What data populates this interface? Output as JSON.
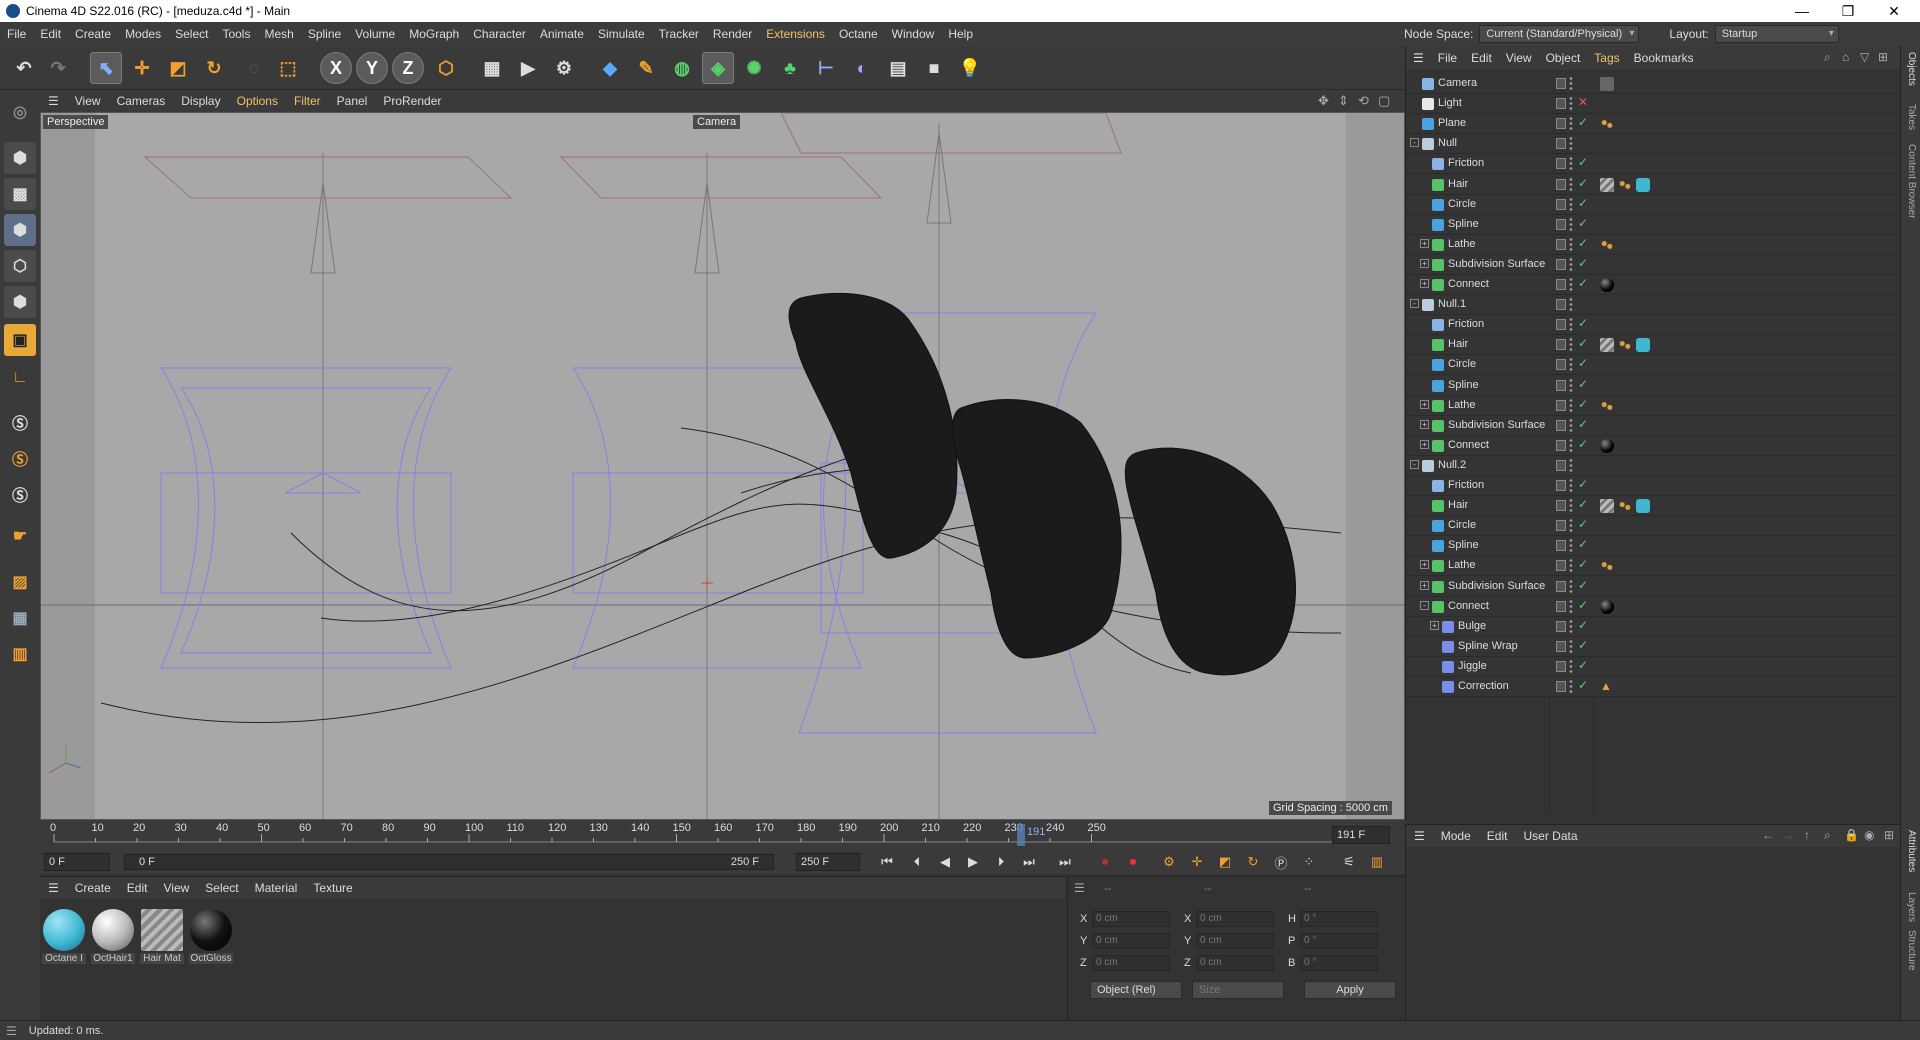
{
  "window": {
    "title": "Cinema 4D S22.016 (RC) - [meduza.c4d *] - Main",
    "minimize": "—",
    "maximize": "❐",
    "close": "✕"
  },
  "menubar": {
    "items": [
      "File",
      "Edit",
      "Create",
      "Modes",
      "Select",
      "Tools",
      "Mesh",
      "Spline",
      "Volume",
      "MoGraph",
      "Character",
      "Animate",
      "Simulate",
      "Tracker",
      "Render",
      "Extensions",
      "Octane",
      "Window",
      "Help"
    ],
    "node_space_label": "Node Space:",
    "node_space_value": "Current (Standard/Physical)",
    "layout_label": "Layout:",
    "layout_value": "Startup"
  },
  "toolbar": {
    "undo": "undo-icon",
    "redo": "redo-icon",
    "axis_x": "X",
    "axis_y": "Y",
    "axis_z": "Z"
  },
  "viewport": {
    "menu": [
      "View",
      "Cameras",
      "Display",
      "Options",
      "Filter",
      "Panel",
      "ProRender"
    ],
    "label": "Perspective",
    "camera_label": "Camera",
    "grid_spacing": "Grid Spacing : 5000 cm"
  },
  "timeline": {
    "ticks": [
      "0",
      "10",
      "20",
      "30",
      "40",
      "50",
      "60",
      "70",
      "80",
      "90",
      "100",
      "110",
      "120",
      "130",
      "140",
      "150",
      "160",
      "170",
      "180",
      "190",
      "200",
      "210",
      "220",
      "230",
      "240",
      "250"
    ],
    "current_marker": "191",
    "current_frame_field": "191 F",
    "start_field": "0 F",
    "range_start": "0 F",
    "range_end": "250 F",
    "end_field": "250 F"
  },
  "materials": {
    "menu": [
      "Create",
      "Edit",
      "View",
      "Select",
      "Material",
      "Texture"
    ],
    "items": [
      {
        "label": "Octane I",
        "color": "#3fb7d2"
      },
      {
        "label": "OctHair1",
        "color": "#bdbdbd"
      },
      {
        "label": "Hair Mat",
        "color": "#9a9a9a"
      },
      {
        "label": "OctGloss",
        "color": "#111111"
      }
    ]
  },
  "coords": {
    "header": [
      "--",
      "--",
      "--"
    ],
    "rows": [
      {
        "a": "X",
        "av": "0 cm",
        "b": "X",
        "bv": "0 cm",
        "c": "H",
        "cv": "0 °"
      },
      {
        "a": "Y",
        "av": "0 cm",
        "b": "Y",
        "bv": "0 cm",
        "c": "P",
        "cv": "0 °"
      },
      {
        "a": "Z",
        "av": "0 cm",
        "b": "Z",
        "bv": "0 cm",
        "c": "B",
        "cv": "0 °"
      }
    ],
    "mode_select": "Object (Rel)",
    "size_select": "Size",
    "apply": "Apply"
  },
  "status": {
    "text": "Updated: 0 ms."
  },
  "object_manager": {
    "menu": [
      "File",
      "Edit",
      "View",
      "Object",
      "Tags",
      "Bookmarks"
    ],
    "objects": [
      {
        "name": "Camera",
        "level": 0,
        "icon": "#8ab4e6",
        "tags": [
          "camera-tag"
        ]
      },
      {
        "name": "Light",
        "level": 0,
        "icon": "#e8e8e8",
        "tags": []
      },
      {
        "name": "Plane",
        "level": 0,
        "icon": "#4aa3e0",
        "tags": [
          "phong"
        ]
      },
      {
        "name": "Null",
        "level": 0,
        "icon": "#bcd",
        "tags": [],
        "tree": "-"
      },
      {
        "name": "Friction",
        "level": 1,
        "icon": "#8ab4e6",
        "tags": []
      },
      {
        "name": "Hair",
        "level": 1,
        "icon": "#58c26a",
        "tags": [
          "hairmat",
          "phong",
          "octane"
        ]
      },
      {
        "name": "Circle",
        "level": 1,
        "icon": "#4aa3e0",
        "tags": []
      },
      {
        "name": "Spline",
        "level": 1,
        "icon": "#4aa3e0",
        "tags": []
      },
      {
        "name": "Lathe",
        "level": 1,
        "icon": "#58c26a",
        "tags": [
          "phong"
        ],
        "tree": "+"
      },
      {
        "name": "Subdivision Surface",
        "level": 1,
        "icon": "#58c26a",
        "tags": [],
        "tree": "+"
      },
      {
        "name": "Connect",
        "level": 1,
        "icon": "#58c26a",
        "tags": [
          "black"
        ],
        "tree": "+"
      },
      {
        "name": "Null.1",
        "level": 0,
        "icon": "#bcd",
        "tags": [],
        "tree": "-"
      },
      {
        "name": "Friction",
        "level": 1,
        "icon": "#8ab4e6",
        "tags": []
      },
      {
        "name": "Hair",
        "level": 1,
        "icon": "#58c26a",
        "tags": [
          "hairmat",
          "phong",
          "octane"
        ]
      },
      {
        "name": "Circle",
        "level": 1,
        "icon": "#4aa3e0",
        "tags": []
      },
      {
        "name": "Spline",
        "level": 1,
        "icon": "#4aa3e0",
        "tags": []
      },
      {
        "name": "Lathe",
        "level": 1,
        "icon": "#58c26a",
        "tags": [
          "phong"
        ],
        "tree": "+"
      },
      {
        "name": "Subdivision Surface",
        "level": 1,
        "icon": "#58c26a",
        "tags": [],
        "tree": "+"
      },
      {
        "name": "Connect",
        "level": 1,
        "icon": "#58c26a",
        "tags": [
          "black"
        ],
        "tree": "+"
      },
      {
        "name": "Null.2",
        "level": 0,
        "icon": "#bcd",
        "tags": [],
        "tree": "-"
      },
      {
        "name": "Friction",
        "level": 1,
        "icon": "#8ab4e6",
        "tags": []
      },
      {
        "name": "Hair",
        "level": 1,
        "icon": "#58c26a",
        "tags": [
          "hairmat",
          "phong",
          "octane"
        ]
      },
      {
        "name": "Circle",
        "level": 1,
        "icon": "#4aa3e0",
        "tags": []
      },
      {
        "name": "Spline",
        "level": 1,
        "icon": "#4aa3e0",
        "tags": []
      },
      {
        "name": "Lathe",
        "level": 1,
        "icon": "#58c26a",
        "tags": [
          "phong"
        ],
        "tree": "+"
      },
      {
        "name": "Subdivision Surface",
        "level": 1,
        "icon": "#58c26a",
        "tags": [],
        "tree": "+"
      },
      {
        "name": "Connect",
        "level": 1,
        "icon": "#58c26a",
        "tags": [
          "black"
        ],
        "tree": "-"
      },
      {
        "name": "Bulge",
        "level": 2,
        "icon": "#7a8de8",
        "tags": [],
        "tree": "+"
      },
      {
        "name": "Spline Wrap",
        "level": 2,
        "icon": "#7a8de8",
        "tags": []
      },
      {
        "name": "Jiggle",
        "level": 2,
        "icon": "#7a8de8",
        "tags": []
      },
      {
        "name": "Correction",
        "level": 2,
        "icon": "#7a8de8",
        "tags": [
          "warning"
        ]
      }
    ]
  },
  "attributes": {
    "menu": [
      "Mode",
      "Edit",
      "User Data"
    ]
  },
  "side_tabs": [
    "Objects",
    "Takes",
    "Content Browser",
    "Attributes",
    "Layers",
    "Structure"
  ]
}
